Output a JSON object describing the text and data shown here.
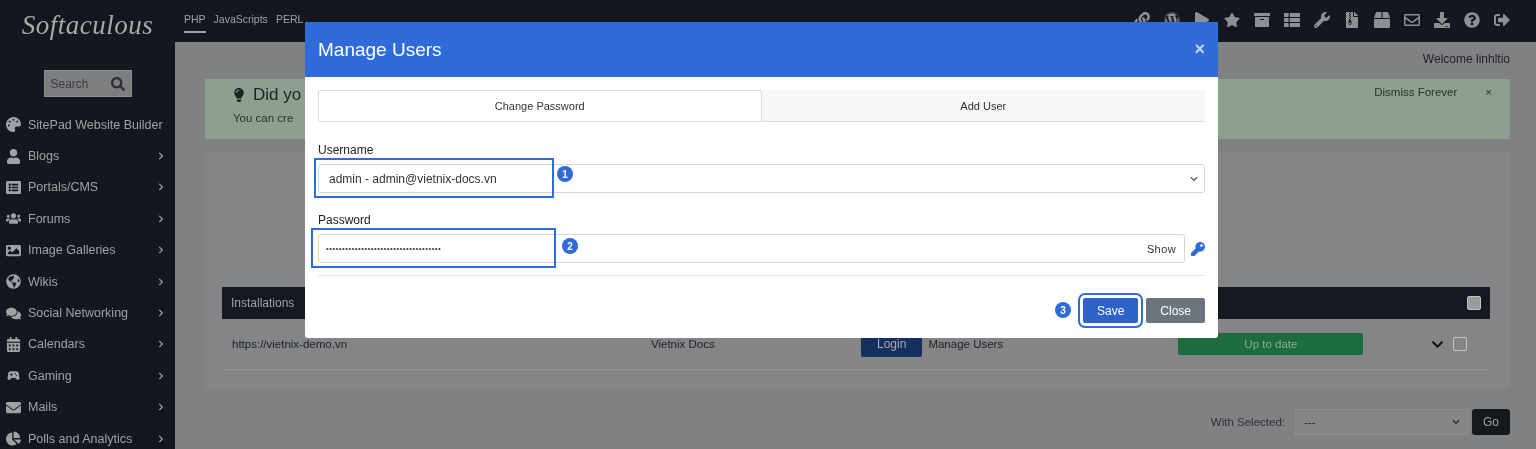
{
  "logo": "Softaculous",
  "search": {
    "placeholder": "Search"
  },
  "sidebar": {
    "items": [
      {
        "label": "SitePad Website Builder",
        "expandable": false
      },
      {
        "label": "Blogs",
        "expandable": true
      },
      {
        "label": "Portals/CMS",
        "expandable": true
      },
      {
        "label": "Forums",
        "expandable": true
      },
      {
        "label": "Image Galleries",
        "expandable": true
      },
      {
        "label": "Wikis",
        "expandable": true
      },
      {
        "label": "Social Networking",
        "expandable": true
      },
      {
        "label": "Calendars",
        "expandable": true
      },
      {
        "label": "Gaming",
        "expandable": true
      },
      {
        "label": "Mails",
        "expandable": true
      },
      {
        "label": "Polls and Analytics",
        "expandable": true
      }
    ]
  },
  "top_tabs": [
    {
      "label": "PHP",
      "selected": true
    },
    {
      "label": "JavaScripts",
      "selected": false
    },
    {
      "label": "PERL",
      "selected": false
    }
  ],
  "welcome": "Welcome linhltio",
  "notice": {
    "title": "Did yo",
    "text": "You can cre",
    "dismiss": "Dismiss Forever",
    "close": "×"
  },
  "installations": {
    "title": "Installations",
    "all_checked": false,
    "rows": [
      {
        "url": "https://vietnix-demo.vn",
        "label": "Vietnix Docs",
        "login": "Login",
        "manage": "Manage Users",
        "status": "Up to date",
        "checked": false
      }
    ]
  },
  "bulk": {
    "label": "With Selected:",
    "value": "---",
    "button": "Go"
  },
  "modal": {
    "title": "Manage Users",
    "close": "×",
    "tabs": [
      {
        "label": "Change Password",
        "selected": true
      },
      {
        "label": "Add User",
        "selected": false
      }
    ],
    "username": {
      "label": "Username",
      "value": "admin - admin@vietnix-docs.vn",
      "callout": "1"
    },
    "password": {
      "label": "Password",
      "value": "••••••••••••••••••••••••••••••••••••",
      "show": "Show",
      "callout": "2"
    },
    "buttons": [
      {
        "label": "Save",
        "kind": "primary",
        "callout": "3"
      },
      {
        "label": "Close",
        "kind": "secondary"
      }
    ]
  }
}
